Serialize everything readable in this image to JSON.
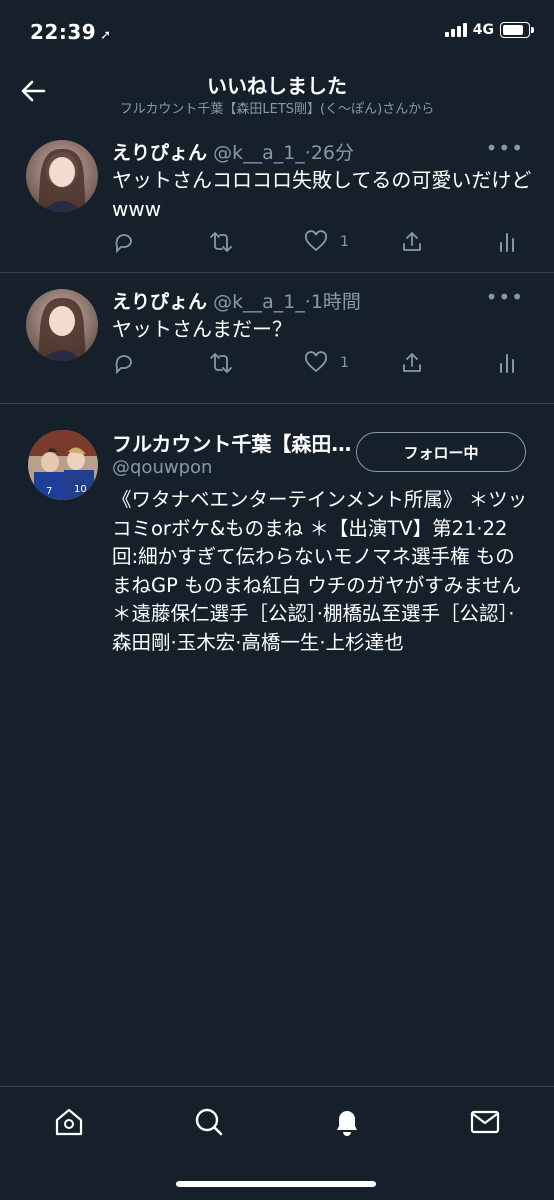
{
  "status_bar": {
    "time": "22:39",
    "network": "4G"
  },
  "header": {
    "title": "いいねしました",
    "subtitle": "フルカウント千葉【森田LETS剛】(く〜ぽん)さんから"
  },
  "tweets": [
    {
      "name": "えりぴょん",
      "handle": "@k__a_1_",
      "time": "·26分",
      "text": "ヤットさんコロコロ失敗してるの可愛いだけどwww",
      "likes": "1"
    },
    {
      "name": "えりぴょん",
      "handle": "@k__a_1_",
      "time": "·1時間",
      "text": "ヤットさんまだー？",
      "likes": "1"
    }
  ],
  "user": {
    "name": "フルカウント千葉【森田...",
    "handle": "@qouwpon",
    "follow_label": "フォロー中",
    "bio": "《ワタナベエンターテインメント所属》 ＊ツッコミorボケ&ものまね ＊【出演TV】第21·22回:細かすぎて伝わらないモノマネ選手権 ものまねGP ものまね紅白 ウチのガヤがすみません＊遠藤保仁選手［公認］·棚橋弘至選手［公認］·森田剛·玉木宏·高橋一生·上杉達也"
  },
  "tabs": [
    "home-icon",
    "search-icon",
    "bell-icon",
    "mail-icon"
  ],
  "colors": {
    "background": "#15202b",
    "secondary_text": "#8899a6",
    "divider": "#38444d"
  }
}
